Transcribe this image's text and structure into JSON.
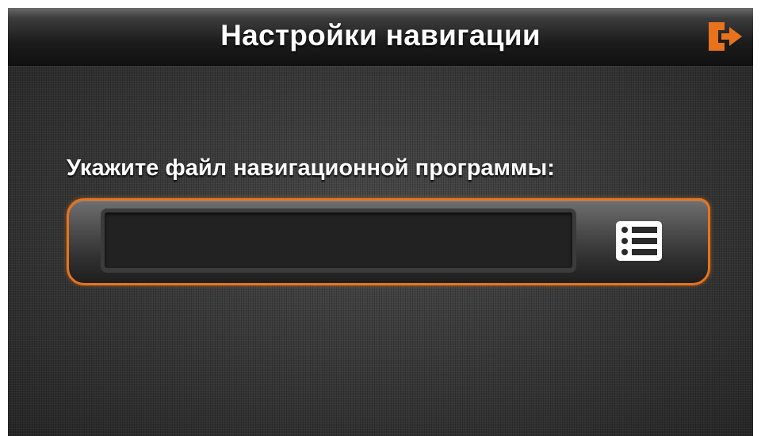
{
  "header": {
    "title": "Настройки навигации",
    "exit_icon": "exit-door-arrow-icon"
  },
  "main": {
    "prompt_label": "Укажите файл навигационной программы:",
    "file_path": {
      "value": "",
      "placeholder": ""
    },
    "browse_icon": "file-list-icon"
  },
  "colors": {
    "accent": "#e8731c",
    "background": "#363636",
    "text": "#ffffff"
  }
}
